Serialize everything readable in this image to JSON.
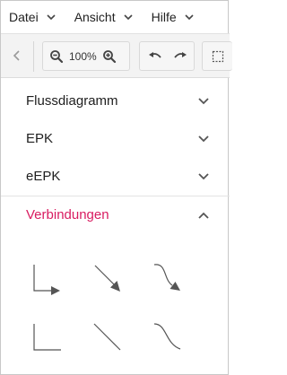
{
  "menubar": {
    "items": [
      {
        "label": "Datei"
      },
      {
        "label": "Ansicht"
      },
      {
        "label": "Hilfe"
      }
    ]
  },
  "toolbar": {
    "zoom_value": "100%",
    "icons": [
      "chevron-left-icon",
      "zoom-out-icon",
      "zoom-in-icon",
      "undo-icon",
      "redo-icon",
      "selection-icon"
    ]
  },
  "sections": [
    {
      "title": "Flussdiagramm",
      "expanded": false
    },
    {
      "title": "EPK",
      "expanded": false
    },
    {
      "title": "eEPK",
      "expanded": false
    },
    {
      "title": "Verbindungen",
      "expanded": true
    }
  ],
  "connectors": [
    "elbow-arrow-connector",
    "straight-arrow-connector",
    "curved-arrow-connector",
    "elbow-line-connector",
    "straight-line-connector",
    "curved-line-connector"
  ],
  "colors": {
    "accent": "#d81b60",
    "toolbar_bg": "#f3f3f3",
    "icon": "#555555"
  }
}
